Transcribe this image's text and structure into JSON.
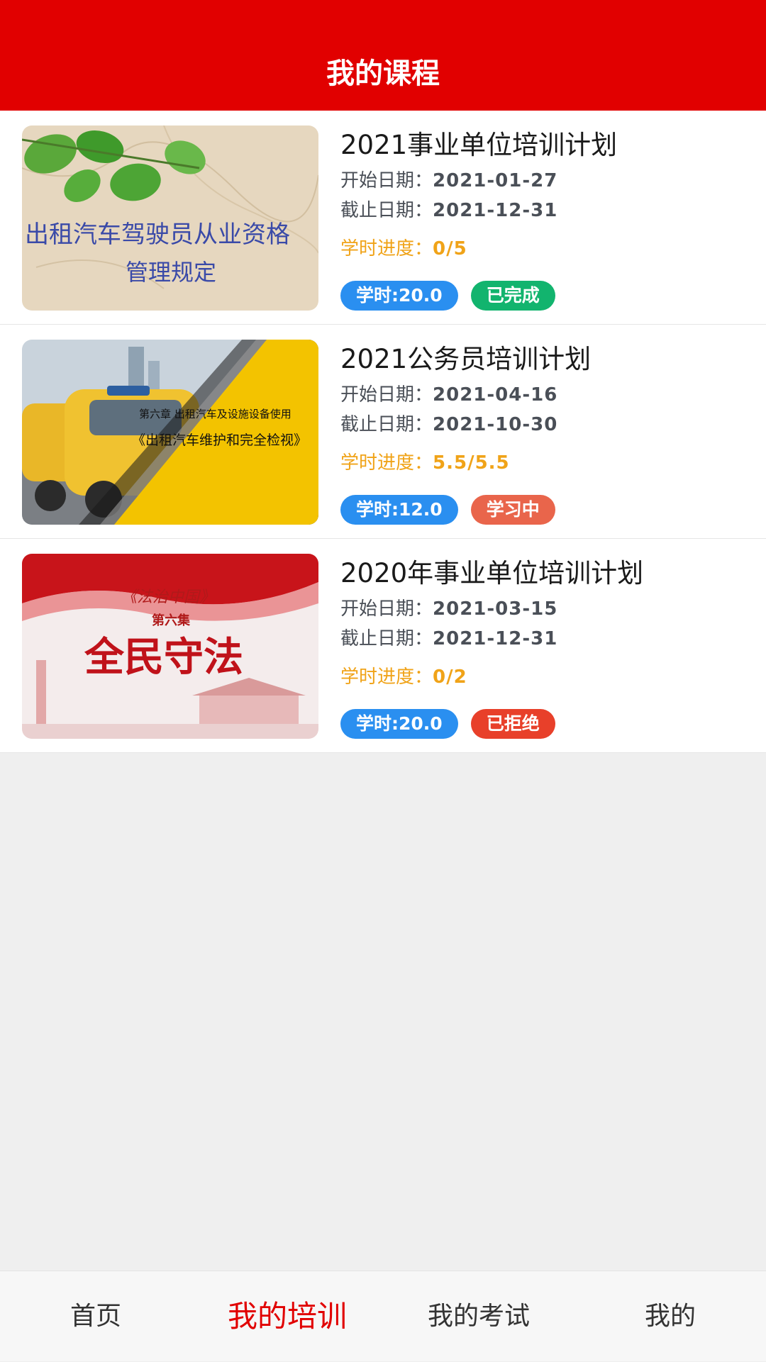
{
  "header": {
    "title": "我的课程"
  },
  "colors": {
    "brand": "#e10000",
    "hours_tag": "#2a8ff0",
    "progress": "#f0a318",
    "status_done": "#12b46e",
    "status_learning": "#e9654b",
    "status_rejected": "#e8402a"
  },
  "courses": [
    {
      "title": "2021事业单位培训计划",
      "start_label": "开始日期：",
      "start_date": "2021-01-27",
      "end_label": "截止日期：",
      "end_date": "2021-12-31",
      "progress_label": "学时进度：",
      "progress": "0/5",
      "hours": "学时:20.0",
      "status": "已完成",
      "thumb": {
        "line1": "出租汽车驾驶员从业资格",
        "line2": "管理规定"
      }
    },
    {
      "title": "2021公务员培训计划",
      "start_label": "开始日期：",
      "start_date": "2021-04-16",
      "end_label": "截止日期：",
      "end_date": "2021-10-30",
      "progress_label": "学时进度：",
      "progress": "5.5/5.5",
      "hours": "学时:12.0",
      "status": "学习中",
      "thumb": {
        "line1": "第六章 出租汽车及设施设备使用",
        "line2": "《出租汽车维护和完全检视》"
      }
    },
    {
      "title": "2020年事业单位培训计划",
      "start_label": "开始日期：",
      "start_date": "2021-03-15",
      "end_label": "截止日期：",
      "end_date": "2021-12-31",
      "progress_label": "学时进度：",
      "progress": "0/2",
      "hours": "学时:20.0",
      "status": "已拒绝",
      "thumb": {
        "line1": "《法治中国》",
        "line2": "第六集",
        "line3": "全民守法"
      }
    }
  ],
  "tabbar": {
    "items": [
      {
        "label": "首页"
      },
      {
        "label": "我的培训"
      },
      {
        "label": "我的考试"
      },
      {
        "label": "我的"
      }
    ],
    "active_index": 1
  }
}
